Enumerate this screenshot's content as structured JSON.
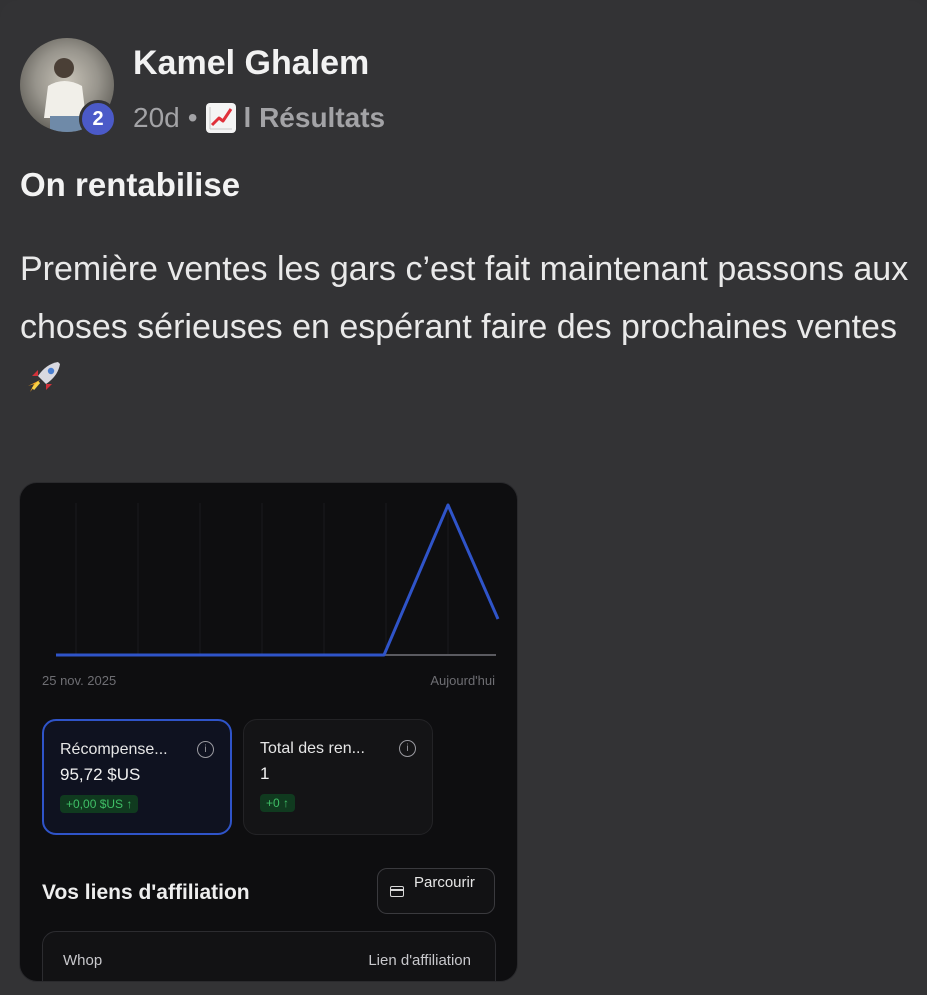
{
  "post": {
    "author": "Kamel Ghalem",
    "level": "2",
    "age": "20d",
    "separator": "•",
    "category": "l Résultats",
    "title": "On rentabilise",
    "body": "Première ventes les gars c’est fait maintenant passons aux choses sérieuses en espérant faire des prochaines ventes",
    "category_icon": "chart-increasing-icon",
    "trailing_emoji": "rocket-icon"
  },
  "embedded": {
    "axis_start": "25 nov. 2025",
    "axis_end": "Aujourd'hui",
    "cards": [
      {
        "label": "Récompense...",
        "value": "95,72 $US",
        "delta": "+0,00 $US ↑"
      },
      {
        "label": "Total des ren...",
        "value": "1",
        "delta": "+0 ↑"
      }
    ],
    "affiliate_title": "Vos liens d'affiliation",
    "browse_label": "Parcourir",
    "table_headers": [
      "Whop",
      "Lien d'affiliation"
    ],
    "accent_color": "#2f54c9"
  }
}
